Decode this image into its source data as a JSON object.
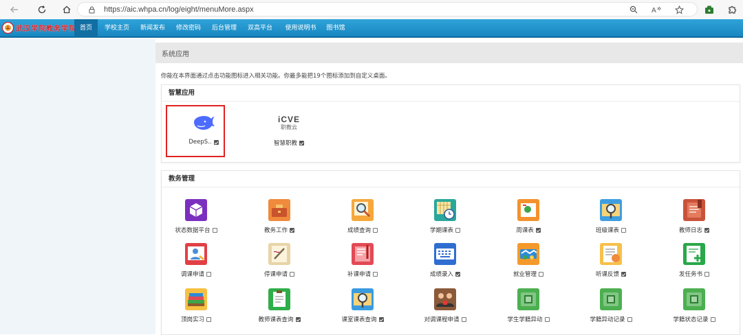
{
  "browser": {
    "url": "https://aic.whpa.cn/log/eight/menuMore.aspx"
  },
  "app": {
    "logo_text": "武汉学院教务学院",
    "nav": [
      "首页",
      "学校主页",
      "新闻发布",
      "修改密码",
      "后台管理",
      "双高平台",
      "使用说明书",
      "图书馆"
    ],
    "accent": "#1e8fc8"
  },
  "main": {
    "title": "系统应用",
    "intro": "你能在本界面通过点击功能图标进入相关功能。你最多能把19个图标添加到自定义桌面。"
  },
  "smart": {
    "header": "智慧应用",
    "tiles": [
      {
        "label": "DeepS..",
        "checked": true,
        "icon": "deepseek-whale-icon"
      },
      {
        "label": "智慧职教",
        "checked": true,
        "icon": "icve-logo-icon",
        "logo_text": "iCVE",
        "logo_sub": "职教云"
      }
    ]
  },
  "edu": {
    "header": "教务管理",
    "tiles": [
      {
        "label": "状态数据平台",
        "checked": false,
        "icon": "cube-icon"
      },
      {
        "label": "教务工作",
        "checked": true,
        "icon": "toolbox-icon"
      },
      {
        "label": "成绩查询",
        "checked": false,
        "icon": "magnifier-icon"
      },
      {
        "label": "学期课表",
        "checked": false,
        "icon": "calendar-clock-icon"
      },
      {
        "label": "周课表",
        "checked": true,
        "icon": "week-schedule-icon"
      },
      {
        "label": "班级课表",
        "checked": false,
        "icon": "search-map-icon"
      },
      {
        "label": "教师日志",
        "checked": true,
        "icon": "journal-icon"
      },
      {
        "label": "调课申请",
        "checked": false,
        "icon": "person-swap-icon"
      },
      {
        "label": "停课申请",
        "checked": false,
        "icon": "pen-paper-icon"
      },
      {
        "label": "补课申请",
        "checked": false,
        "icon": "book-red-icon"
      },
      {
        "label": "成绩录入",
        "checked": true,
        "icon": "keyboard-icon"
      },
      {
        "label": "就业管理",
        "checked": false,
        "icon": "handshake-icon"
      },
      {
        "label": "听课反馈",
        "checked": true,
        "icon": "feedback-doc-icon"
      },
      {
        "label": "发任务书",
        "checked": false,
        "icon": "doc-plus-icon"
      },
      {
        "label": "顶岗实习",
        "checked": false,
        "icon": "books-stack-icon"
      },
      {
        "label": "教师课表查询",
        "checked": true,
        "icon": "clipboard-icon"
      },
      {
        "label": "课室课表查询",
        "checked": true,
        "icon": "room-search-icon"
      },
      {
        "label": "对调课程申请",
        "checked": false,
        "icon": "people-swap-icon"
      },
      {
        "label": "学生学籍异动",
        "checked": false,
        "icon": "student-folder-icon"
      },
      {
        "label": "学籍异动记录",
        "checked": false,
        "icon": "record-folder-icon"
      },
      {
        "label": "学籍状态记录",
        "checked": false,
        "icon": "status-folder-icon"
      }
    ]
  }
}
